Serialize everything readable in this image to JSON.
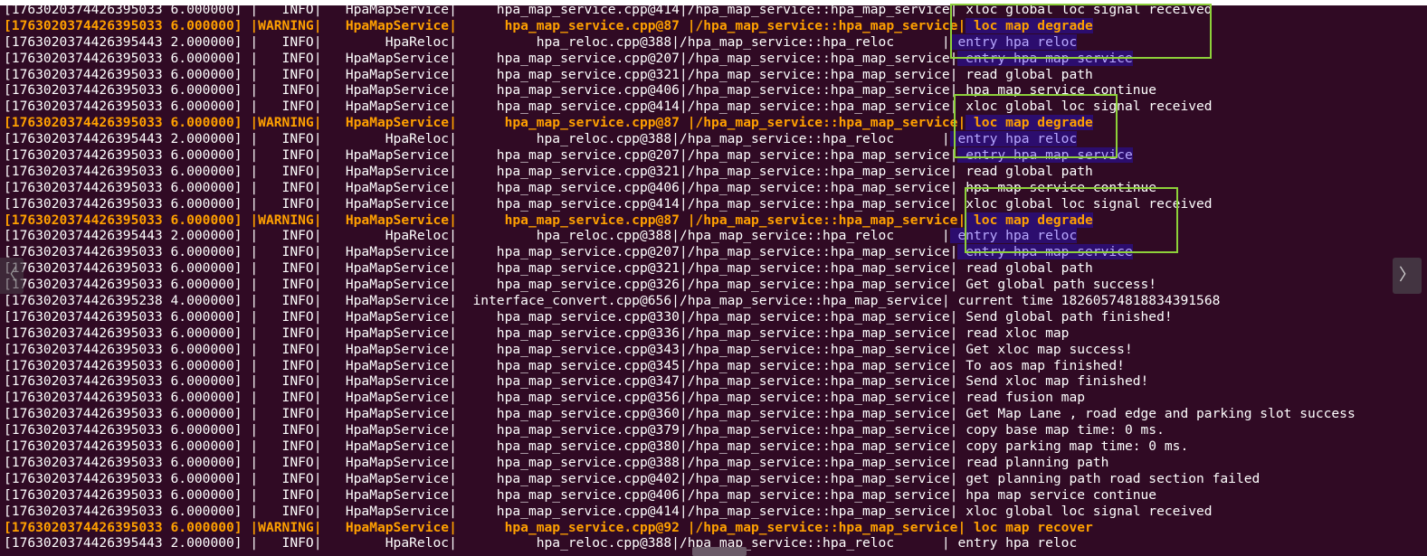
{
  "terminal": {
    "lines": [
      {
        "ts": "[1763020374426395033 6.000000]",
        "level": "   INFO",
        "module": "   HpaMapService",
        "file": "     hpa_map_service.cpp@414",
        "func": "/hpa_map_service::hpa_map_service",
        "msg": " xloc global loc signal received",
        "warn": false
      },
      {
        "ts": "[1763020374426395033 6.000000]",
        "level": "WARNING",
        "module": "   HpaMapService",
        "file": "      hpa_map_service.cpp@87 ",
        "func": "/hpa_map_service::hpa_map_service",
        "msg": " loc map degrade",
        "warn": true
      },
      {
        "ts": "[1763020374426395443 2.000000]",
        "level": "   INFO",
        "module": "        HpaReloc",
        "file": "          hpa_reloc.cpp@388",
        "func": "/hpa_map_service::hpa_reloc      ",
        "msg": " entry hpa reloc",
        "warn": false
      },
      {
        "ts": "[1763020374426395033 6.000000]",
        "level": "   INFO",
        "module": "   HpaMapService",
        "file": "     hpa_map_service.cpp@207",
        "func": "/hpa_map_service::hpa_map_service",
        "msg": " entry hpa map service",
        "warn": false
      },
      {
        "ts": "[1763020374426395033 6.000000]",
        "level": "   INFO",
        "module": "   HpaMapService",
        "file": "     hpa_map_service.cpp@321",
        "func": "/hpa_map_service::hpa_map_service",
        "msg": " read global path",
        "warn": false
      },
      {
        "ts": "[1763020374426395033 6.000000]",
        "level": "   INFO",
        "module": "   HpaMapService",
        "file": "     hpa_map_service.cpp@406",
        "func": "/hpa_map_service::hpa_map_service",
        "msg": " hpa map service continue",
        "warn": false
      },
      {
        "ts": "[1763020374426395033 6.000000]",
        "level": "   INFO",
        "module": "   HpaMapService",
        "file": "     hpa_map_service.cpp@414",
        "func": "/hpa_map_service::hpa_map_service",
        "msg": " xloc global loc signal received",
        "warn": false
      },
      {
        "ts": "[1763020374426395033 6.000000]",
        "level": "WARNING",
        "module": "   HpaMapService",
        "file": "      hpa_map_service.cpp@87 ",
        "func": "/hpa_map_service::hpa_map_service",
        "msg": " loc map degrade",
        "warn": true
      },
      {
        "ts": "[1763020374426395443 2.000000]",
        "level": "   INFO",
        "module": "        HpaReloc",
        "file": "          hpa_reloc.cpp@388",
        "func": "/hpa_map_service::hpa_reloc      ",
        "msg": " entry hpa reloc",
        "warn": false
      },
      {
        "ts": "[1763020374426395033 6.000000]",
        "level": "   INFO",
        "module": "   HpaMapService",
        "file": "     hpa_map_service.cpp@207",
        "func": "/hpa_map_service::hpa_map_service",
        "msg": " entry hpa map service",
        "warn": false
      },
      {
        "ts": "[1763020374426395033 6.000000]",
        "level": "   INFO",
        "module": "   HpaMapService",
        "file": "     hpa_map_service.cpp@321",
        "func": "/hpa_map_service::hpa_map_service",
        "msg": " read global path",
        "warn": false
      },
      {
        "ts": "[1763020374426395033 6.000000]",
        "level": "   INFO",
        "module": "   HpaMapService",
        "file": "     hpa_map_service.cpp@406",
        "func": "/hpa_map_service::hpa_map_service",
        "msg": " hpa map service continue",
        "warn": false
      },
      {
        "ts": "[1763020374426395033 6.000000]",
        "level": "   INFO",
        "module": "   HpaMapService",
        "file": "     hpa_map_service.cpp@414",
        "func": "/hpa_map_service::hpa_map_service",
        "msg": " xloc global loc signal received",
        "warn": false
      },
      {
        "ts": "[1763020374426395033 6.000000]",
        "level": "WARNING",
        "module": "   HpaMapService",
        "file": "      hpa_map_service.cpp@87 ",
        "func": "/hpa_map_service::hpa_map_service",
        "msg": " loc map degrade",
        "warn": true
      },
      {
        "ts": "[1763020374426395443 2.000000]",
        "level": "   INFO",
        "module": "        HpaReloc",
        "file": "          hpa_reloc.cpp@388",
        "func": "/hpa_map_service::hpa_reloc      ",
        "msg": " entry hpa reloc",
        "warn": false
      },
      {
        "ts": "[1763020374426395033 6.000000]",
        "level": "   INFO",
        "module": "   HpaMapService",
        "file": "     hpa_map_service.cpp@207",
        "func": "/hpa_map_service::hpa_map_service",
        "msg": " entry hpa map service",
        "warn": false
      },
      {
        "ts": "[1763020374426395033 6.000000]",
        "level": "   INFO",
        "module": "   HpaMapService",
        "file": "     hpa_map_service.cpp@321",
        "func": "/hpa_map_service::hpa_map_service",
        "msg": " read global path",
        "warn": false
      },
      {
        "ts": "[1763020374426395033 6.000000]",
        "level": "   INFO",
        "module": "   HpaMapService",
        "file": "     hpa_map_service.cpp@326",
        "func": "/hpa_map_service::hpa_map_service",
        "msg": " Get global path success!",
        "warn": false
      },
      {
        "ts": "[1763020374426395238 4.000000]",
        "level": "   INFO",
        "module": "   HpaMapService",
        "file": "  interface_convert.cpp@656",
        "func": "/hpa_map_service::hpa_map_service",
        "msg": " current time 18260574818834391568",
        "warn": false
      },
      {
        "ts": "[1763020374426395033 6.000000]",
        "level": "   INFO",
        "module": "   HpaMapService",
        "file": "     hpa_map_service.cpp@330",
        "func": "/hpa_map_service::hpa_map_service",
        "msg": " Send global path finished!",
        "warn": false
      },
      {
        "ts": "[1763020374426395033 6.000000]",
        "level": "   INFO",
        "module": "   HpaMapService",
        "file": "     hpa_map_service.cpp@336",
        "func": "/hpa_map_service::hpa_map_service",
        "msg": " read xloc map",
        "warn": false
      },
      {
        "ts": "[1763020374426395033 6.000000]",
        "level": "   INFO",
        "module": "   HpaMapService",
        "file": "     hpa_map_service.cpp@343",
        "func": "/hpa_map_service::hpa_map_service",
        "msg": " Get xloc map success!",
        "warn": false
      },
      {
        "ts": "[1763020374426395033 6.000000]",
        "level": "   INFO",
        "module": "   HpaMapService",
        "file": "     hpa_map_service.cpp@345",
        "func": "/hpa_map_service::hpa_map_service",
        "msg": " To aos map finished!",
        "warn": false
      },
      {
        "ts": "[1763020374426395033 6.000000]",
        "level": "   INFO",
        "module": "   HpaMapService",
        "file": "     hpa_map_service.cpp@347",
        "func": "/hpa_map_service::hpa_map_service",
        "msg": " Send xloc map finished!",
        "warn": false
      },
      {
        "ts": "[1763020374426395033 6.000000]",
        "level": "   INFO",
        "module": "   HpaMapService",
        "file": "     hpa_map_service.cpp@356",
        "func": "/hpa_map_service::hpa_map_service",
        "msg": " read fusion map",
        "warn": false
      },
      {
        "ts": "[1763020374426395033 6.000000]",
        "level": "   INFO",
        "module": "   HpaMapService",
        "file": "     hpa_map_service.cpp@360",
        "func": "/hpa_map_service::hpa_map_service",
        "msg": " Get Map Lane , road edge and parking slot success",
        "warn": false
      },
      {
        "ts": "[1763020374426395033 6.000000]",
        "level": "   INFO",
        "module": "   HpaMapService",
        "file": "     hpa_map_service.cpp@379",
        "func": "/hpa_map_service::hpa_map_service",
        "msg": " copy base map time: 0 ms.",
        "warn": false
      },
      {
        "ts": "[1763020374426395033 6.000000]",
        "level": "   INFO",
        "module": "   HpaMapService",
        "file": "     hpa_map_service.cpp@380",
        "func": "/hpa_map_service::hpa_map_service",
        "msg": " copy parking map time: 0 ms.",
        "warn": false
      },
      {
        "ts": "[1763020374426395033 6.000000]",
        "level": "   INFO",
        "module": "   HpaMapService",
        "file": "     hpa_map_service.cpp@388",
        "func": "/hpa_map_service::hpa_map_service",
        "msg": " read planning path",
        "warn": false
      },
      {
        "ts": "[1763020374426395033 6.000000]",
        "level": "   INFO",
        "module": "   HpaMapService",
        "file": "     hpa_map_service.cpp@402",
        "func": "/hpa_map_service::hpa_map_service",
        "msg": " get planning path road section failed",
        "warn": false
      },
      {
        "ts": "[1763020374426395033 6.000000]",
        "level": "   INFO",
        "module": "   HpaMapService",
        "file": "     hpa_map_service.cpp@406",
        "func": "/hpa_map_service::hpa_map_service",
        "msg": " hpa map service continue",
        "warn": false
      },
      {
        "ts": "[1763020374426395033 6.000000]",
        "level": "   INFO",
        "module": "   HpaMapService",
        "file": "     hpa_map_service.cpp@414",
        "func": "/hpa_map_service::hpa_map_service",
        "msg": " xloc global loc signal received",
        "warn": false
      },
      {
        "ts": "[1763020374426395033 6.000000]",
        "level": "WARNING",
        "module": "   HpaMapService",
        "file": "      hpa_map_service.cpp@92 ",
        "func": "/hpa_map_service::hpa_map_service",
        "msg": " loc map recover",
        "warn": true
      },
      {
        "ts": "[1763020374426395443 2.000000]",
        "level": "   INFO",
        "module": "        HpaReloc",
        "file": "          hpa_reloc.cpp@388",
        "func": "/hpa_map_service::hpa_reloc      ",
        "msg": " entry hpa reloc",
        "warn": false
      }
    ],
    "highlighted_rows": [
      1,
      2,
      3,
      7,
      8,
      9,
      13,
      14,
      15
    ]
  },
  "nav": {
    "prev_glyph": "〈",
    "next_glyph": "〉"
  }
}
